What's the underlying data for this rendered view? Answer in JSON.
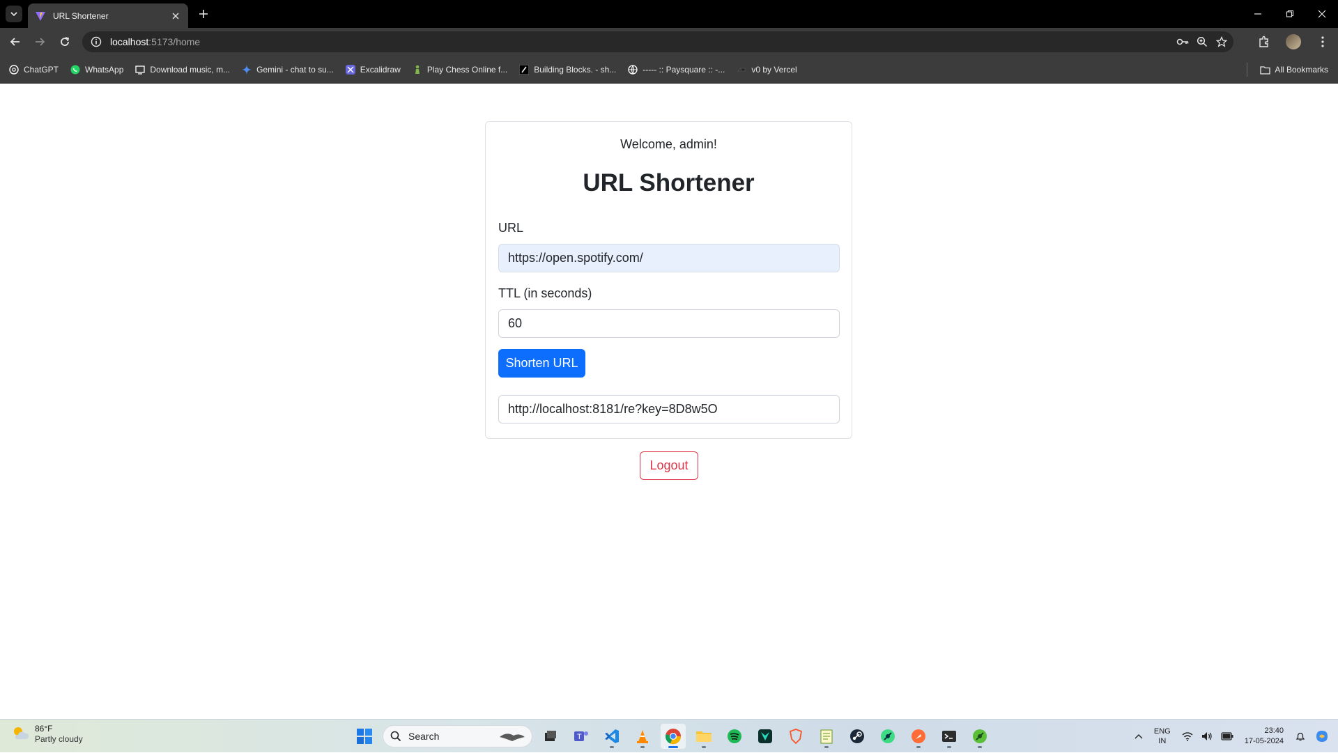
{
  "browser": {
    "tab_title": "URL Shortener",
    "url_host": "localhost",
    "url_path": ":5173/home",
    "bookmarks": [
      {
        "label": "ChatGPT",
        "icon": "chatgpt-icon"
      },
      {
        "label": "WhatsApp",
        "icon": "whatsapp-icon"
      },
      {
        "label": "Download music, m...",
        "icon": "download-icon"
      },
      {
        "label": "Gemini - chat to su...",
        "icon": "gemini-icon"
      },
      {
        "label": "Excalidraw",
        "icon": "excalidraw-icon"
      },
      {
        "label": "Play Chess Online f...",
        "icon": "chess-icon"
      },
      {
        "label": "Building Blocks. - sh...",
        "icon": "blocks-icon"
      },
      {
        "label": "----- :: Paysquare :: -...",
        "icon": "globe-icon"
      },
      {
        "label": "v0 by Vercel",
        "icon": "vercel-icon"
      }
    ],
    "all_bookmarks": "All Bookmarks"
  },
  "page": {
    "welcome": "Welcome, admin!",
    "title": "URL Shortener",
    "url_label": "URL",
    "url_value": "https://open.spotify.com/",
    "ttl_label": "TTL (in seconds)",
    "ttl_value": "60",
    "shorten_button": "Shorten URL",
    "short_url": "http://localhost:8181/re?key=8D8w5O",
    "logout_button": "Logout"
  },
  "taskbar": {
    "weather_temp": "86°F",
    "weather_desc": "Partly cloudy",
    "search_label": "Search",
    "lang_line1": "ENG",
    "lang_line2": "IN",
    "time": "23:40",
    "date": "17-05-2024"
  },
  "colors": {
    "primary": "#0d6efd",
    "danger": "#dc3545",
    "autofill": "#e8f0fe"
  }
}
